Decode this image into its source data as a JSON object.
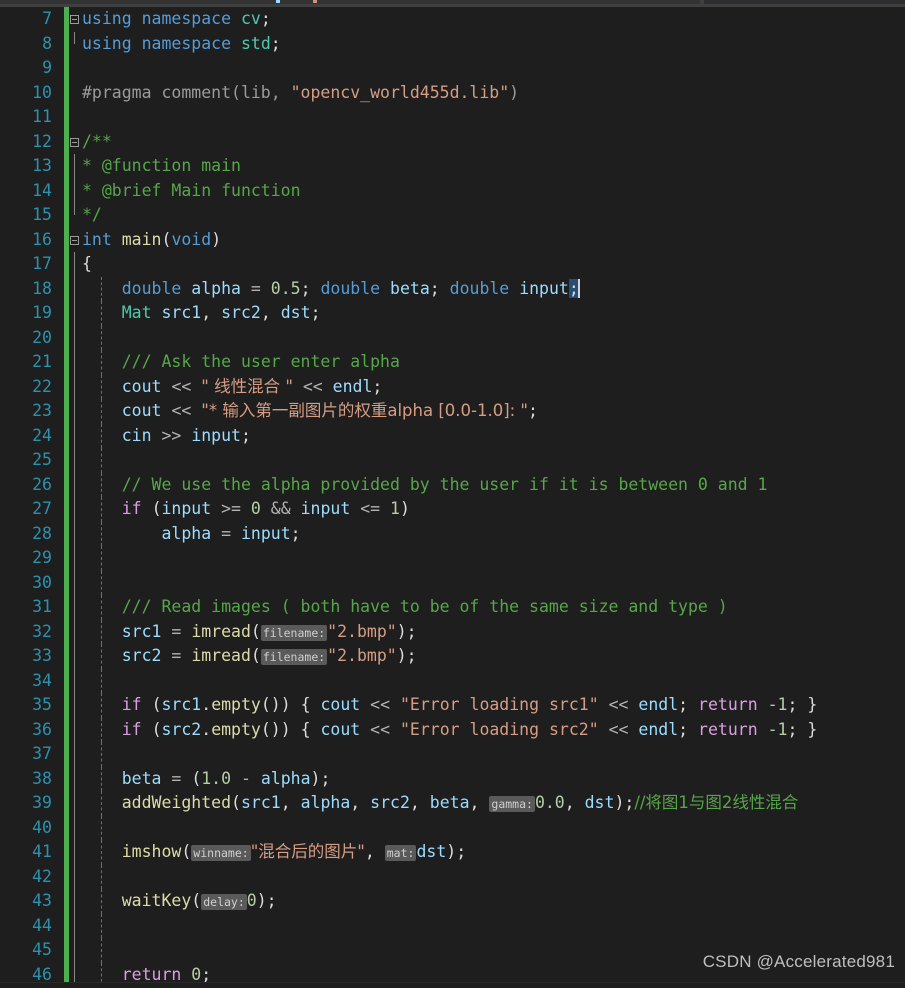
{
  "app": {
    "name": "Visual Studio",
    "theme": "dark",
    "language": "C++"
  },
  "colors": {
    "background": "#1e1e1e",
    "line_number": "#2b91af",
    "keyword": "#569cd6",
    "control_keyword": "#d8a0df",
    "type": "#4ec9b0",
    "variable": "#9cdcfe",
    "function": "#dcdcaa",
    "string": "#d69d85",
    "number": "#b5cea8",
    "comment": "#57a64a",
    "preprocessor": "#9b9b9b",
    "change_bar": "#4caf50",
    "selection": "#264f78",
    "hint_background": "#5a5a5a"
  },
  "gutter": {
    "first_line": 7,
    "last_line": 46
  },
  "watermark": {
    "text": "CSDN @Accelerated981"
  },
  "lines": [
    {
      "n": "7",
      "fold": "open",
      "guide": "start"
    },
    {
      "n": "8",
      "fold": "none",
      "guide": "end"
    },
    {
      "n": "9",
      "fold": "none",
      "guide": "none"
    },
    {
      "n": "10",
      "fold": "none",
      "guide": "none"
    },
    {
      "n": "11",
      "fold": "none",
      "guide": "none"
    },
    {
      "n": "12",
      "fold": "open",
      "guide": "start"
    },
    {
      "n": "13",
      "fold": "none",
      "guide": "line"
    },
    {
      "n": "14",
      "fold": "none",
      "guide": "line"
    },
    {
      "n": "15",
      "fold": "none",
      "guide": "end"
    },
    {
      "n": "16",
      "fold": "open",
      "guide": "start"
    },
    {
      "n": "17",
      "fold": "none",
      "guide": "line"
    },
    {
      "n": "18",
      "fold": "none",
      "guide": "line"
    },
    {
      "n": "19",
      "fold": "none",
      "guide": "line"
    },
    {
      "n": "20",
      "fold": "none",
      "guide": "line"
    },
    {
      "n": "21",
      "fold": "none",
      "guide": "line"
    },
    {
      "n": "22",
      "fold": "none",
      "guide": "line"
    },
    {
      "n": "23",
      "fold": "none",
      "guide": "line"
    },
    {
      "n": "24",
      "fold": "none",
      "guide": "line"
    },
    {
      "n": "25",
      "fold": "none",
      "guide": "line"
    },
    {
      "n": "26",
      "fold": "none",
      "guide": "line"
    },
    {
      "n": "27",
      "fold": "none",
      "guide": "line"
    },
    {
      "n": "28",
      "fold": "none",
      "guide": "line"
    },
    {
      "n": "29",
      "fold": "none",
      "guide": "line"
    },
    {
      "n": "30",
      "fold": "none",
      "guide": "line"
    },
    {
      "n": "31",
      "fold": "none",
      "guide": "line"
    },
    {
      "n": "32",
      "fold": "none",
      "guide": "line"
    },
    {
      "n": "33",
      "fold": "none",
      "guide": "line"
    },
    {
      "n": "34",
      "fold": "none",
      "guide": "line"
    },
    {
      "n": "35",
      "fold": "none",
      "guide": "line"
    },
    {
      "n": "36",
      "fold": "none",
      "guide": "line"
    },
    {
      "n": "37",
      "fold": "none",
      "guide": "line"
    },
    {
      "n": "38",
      "fold": "none",
      "guide": "line"
    },
    {
      "n": "39",
      "fold": "none",
      "guide": "line"
    },
    {
      "n": "40",
      "fold": "none",
      "guide": "line"
    },
    {
      "n": "41",
      "fold": "none",
      "guide": "line"
    },
    {
      "n": "42",
      "fold": "none",
      "guide": "line"
    },
    {
      "n": "43",
      "fold": "none",
      "guide": "line"
    },
    {
      "n": "44",
      "fold": "none",
      "guide": "line"
    },
    {
      "n": "45",
      "fold": "none",
      "guide": "line"
    },
    {
      "n": "46",
      "fold": "none",
      "guide": "line"
    }
  ],
  "code": {
    "l7": "using namespace cv;",
    "l8": "using namespace std;",
    "l9": "",
    "l10": "#pragma comment(lib, \"opencv_world455d.lib\")",
    "l11": "",
    "l12": "/**",
    "l13": "* @function main",
    "l14": "* @brief Main function",
    "l15": "*/",
    "l16": "int main(void)",
    "l17": "{",
    "l18": "    double alpha = 0.5; double beta; double input;",
    "l19": "    Mat src1, src2, dst;",
    "l20": "",
    "l21": "    /// Ask the user enter alpha",
    "l22": "    cout << \" 线性混合 \" << endl;",
    "l23": "    cout << \"* 输入第一副图片的权重alpha [0.0-1.0]: \";",
    "l24": "    cin >> input;",
    "l25": "",
    "l26": "    // We use the alpha provided by the user if it is between 0 and 1",
    "l27": "    if (input >= 0 && input <= 1)",
    "l28": "        alpha = input;",
    "l29": "",
    "l30": "",
    "l31": "    /// Read images ( both have to be of the same size and type )",
    "l32": "    src1 = imread(filename:\"2.bmp\");",
    "l33": "    src2 = imread(filename:\"2.bmp\");",
    "l34": "",
    "l35": "    if (src1.empty()) { cout << \"Error loading src1\" << endl; return -1; }",
    "l36": "    if (src2.empty()) { cout << \"Error loading src2\" << endl; return -1; }",
    "l37": "",
    "l38": "    beta = (1.0 - alpha);",
    "l39": "    addWeighted(src1, alpha, src2, beta, gamma:0.0, dst);//将图1与图2线性混合",
    "l40": "",
    "l41": "    imshow(winname:\"混合后的图片\", mat:dst);",
    "l42": "",
    "l43": "    waitKey(delay:0);",
    "l44": "",
    "l45": "",
    "l46": "    return 0;"
  },
  "tokens": {
    "kw_using": "using",
    "kw_namespace": "namespace",
    "ns_cv": "cv",
    "ns_std": "std",
    "semi": ";",
    "pragma": "#pragma comment(lib, ",
    "pragma_str": "\"opencv_world455d.lib\"",
    "pragma_close": ")",
    "doc_open": "/**",
    "doc_function": "* @function main",
    "doc_brief": "* @brief Main function",
    "doc_close": "*/",
    "kw_int": "int",
    "fn_main": "main",
    "paren_open": "(",
    "kw_void": "void",
    "paren_close": ")",
    "brace_open": "{",
    "kw_double": "double",
    "var_alpha": "alpha",
    "eq": " = ",
    "num_half": "0.5",
    "var_beta": "beta",
    "var_input": "input",
    "type_mat": "Mat",
    "var_src1": "src1",
    "var_src2": "src2",
    "var_dst": "dst",
    "cmt_ask": "/// Ask the user enter alpha",
    "var_cout": "cout",
    "shift_left": "<<",
    "shift_right": ">>",
    "str_blend": "\" 线性混合 \"",
    "var_endl": "endl",
    "str_prompt": "\"* 输入第一副图片的权重alpha [0.0-1.0]: \"",
    "var_cin": "cin",
    "cmt_weuse": "// We use the alpha provided by the user if it is between 0 and 1",
    "kw_if": "if",
    "op_ge": ">=",
    "op_and": "&&",
    "op_le": "<=",
    "num_zero": "0",
    "num_one": "1",
    "cmt_read": "/// Read images ( both have to be of the same size and type )",
    "fn_imread": "imread",
    "hint_filename": "filename:",
    "str_2bmp": "\"2.bmp\"",
    "fn_empty": "empty",
    "str_err1": "\"Error loading src1\"",
    "str_err2": "\"Error loading src2\"",
    "kw_return": "return",
    "num_minus1": "-1",
    "brace_close": "}",
    "num_1_0": "1.0",
    "op_minus": "-",
    "fn_addweighted": "addWeighted",
    "hint_gamma": "gamma:",
    "num_0_0": "0.0",
    "cmt_blend": "//将图1与图2线性混合",
    "fn_imshow": "imshow",
    "hint_winname": "winname:",
    "str_window": "\"混合后的图片\"",
    "hint_mat": "mat:",
    "fn_waitkey": "waitKey",
    "hint_delay": "delay:",
    "num_0": "0"
  }
}
